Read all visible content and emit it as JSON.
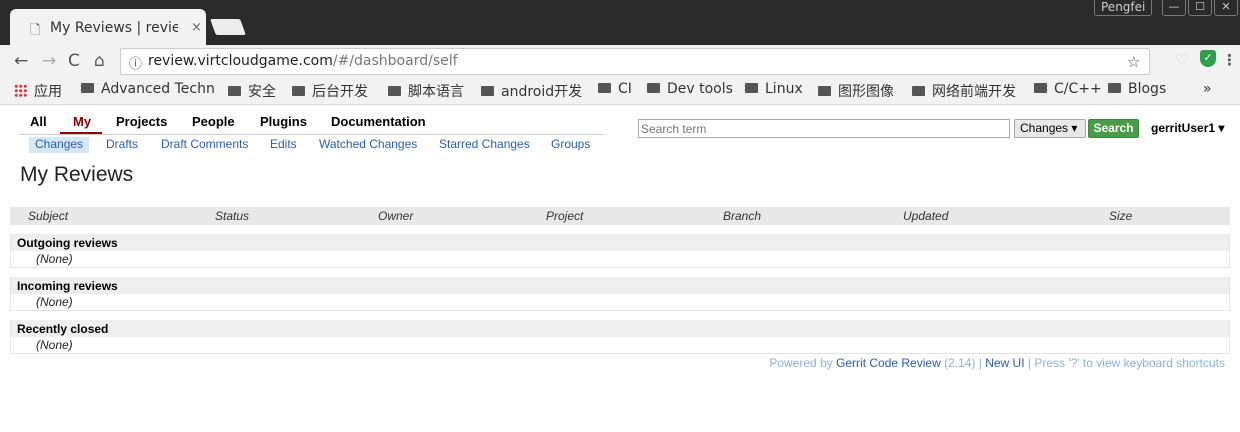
{
  "browser": {
    "tab_title": "My Reviews | review.virtcloudgame.com",
    "tab_close": "×",
    "profile_name": "Pengfei",
    "window_buttons": [
      "—",
      "☐",
      "✕"
    ],
    "url_host": "review.virtcloudgame.com",
    "url_path": "/#/dashboard/self",
    "bookmarks": [
      {
        "label": "应用",
        "icon": "apps-icon"
      },
      {
        "label": "Advanced Techn",
        "icon": "folder-icon"
      },
      {
        "label": "安全",
        "icon": "folder-icon"
      },
      {
        "label": "后台开发",
        "icon": "folder-icon"
      },
      {
        "label": "脚本语言",
        "icon": "folder-icon"
      },
      {
        "label": "android开发",
        "icon": "folder-icon"
      },
      {
        "label": "CI",
        "icon": "folder-icon"
      },
      {
        "label": "Dev tools",
        "icon": "folder-icon"
      },
      {
        "label": "Linux",
        "icon": "folder-icon"
      },
      {
        "label": "图形图像",
        "icon": "folder-icon"
      },
      {
        "label": "网络前端开发",
        "icon": "folder-icon"
      },
      {
        "label": "C/C++",
        "icon": "folder-icon"
      },
      {
        "label": "Blogs",
        "icon": "folder-icon"
      }
    ],
    "bookmarks_more": "»"
  },
  "gerrit": {
    "menu": [
      "All",
      "My",
      "Projects",
      "People",
      "Plugins",
      "Documentation"
    ],
    "selected_menu": "My",
    "submenu": [
      "Changes",
      "Drafts",
      "Draft Comments",
      "Edits",
      "Watched Changes",
      "Starred Changes",
      "Groups"
    ],
    "active_submenu": "Changes",
    "search": {
      "placeholder": "Search term",
      "type": "Changes ▾",
      "button": "Search"
    },
    "user": "gerritUser1 ▾",
    "page_title": "My Reviews",
    "table": {
      "columns": [
        "Subject",
        "Status",
        "Owner",
        "Project",
        "Branch",
        "Updated",
        "Size"
      ],
      "sections": [
        {
          "title": "Outgoing reviews",
          "empty": "(None)"
        },
        {
          "title": "Incoming reviews",
          "empty": "(None)"
        },
        {
          "title": "Recently closed",
          "empty": "(None)"
        }
      ]
    },
    "footer": {
      "powered_by": "Powered by ",
      "link": "Gerrit Code Review",
      "version": " (2.14) | ",
      "new_ui": "New UI",
      "shortcuts": " | Press '?' to view keyboard shortcuts"
    }
  },
  "colors": {
    "accent": "#8b0000",
    "link": "#2a5db0",
    "search_button": "#4a9c4a"
  }
}
